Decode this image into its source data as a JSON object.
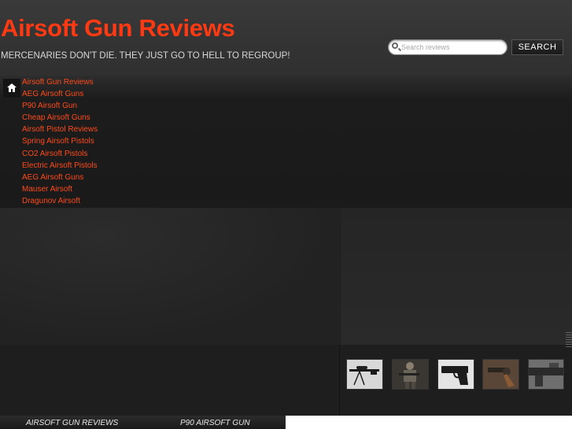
{
  "header": {
    "site_title": "Airsoft Gun Reviews",
    "tagline": "MERCENARIES DON'T DIE. THEY JUST GO TO HELL TO REGROUP!",
    "search_placeholder": "Search reviews",
    "search_button": "SEARCH"
  },
  "nav": {
    "home_icon": "home-icon",
    "items": [
      {
        "label": "Airsoft Gun Reviews"
      },
      {
        "label": "AEG Airsoft Guns"
      },
      {
        "label": "P90 Airsoft Gun"
      },
      {
        "label": "Cheap Airsoft Guns"
      },
      {
        "label": "Airsoft Pistol Reviews"
      },
      {
        "label": "Spring Airsoft Pistols"
      },
      {
        "label": "CO2 Airsoft Pistols"
      },
      {
        "label": "Electric Airsoft Pistols"
      },
      {
        "label": "AEG Airsoft Guns"
      },
      {
        "label": "Mauser Airsoft"
      },
      {
        "label": "Dragunov Airsoft"
      }
    ]
  },
  "thumbnails": [
    {
      "icon": "sniper-rifle-thumbnail"
    },
    {
      "icon": "soldier-thumbnail"
    },
    {
      "icon": "pistol-thumbnail"
    },
    {
      "icon": "revolver-thumbnail"
    },
    {
      "icon": "rifle-closeup-thumbnail"
    }
  ],
  "footer_nav": {
    "links": [
      "AIRSOFT GUN REVIEWS",
      "P90 AIRSOFT GUN"
    ]
  },
  "colors": {
    "accent": "#ff3a12",
    "link": "#ff4a1a",
    "background": "#2a2a2a"
  }
}
